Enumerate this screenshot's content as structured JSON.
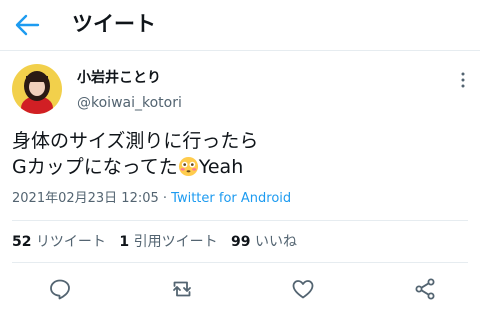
{
  "header": {
    "title": "ツイート"
  },
  "user": {
    "name": "小岩井ことり",
    "handle": "@koiwai_kotori"
  },
  "tweet": {
    "line1": "身体のサイズ測りに行ったら",
    "line2": "Gカップになってた",
    "line2_suffix": "Yeah",
    "emoji": "flushed-face-icon"
  },
  "meta": {
    "datetime": "2021年02月23日 12:05",
    "separator": " · ",
    "source": "Twitter for Android"
  },
  "stats": {
    "retweets": {
      "count": "52",
      "label": "リツイート"
    },
    "quotes": {
      "count": "1",
      "label": "引用ツイート"
    },
    "likes": {
      "count": "99",
      "label": "いいね"
    }
  },
  "colors": {
    "accent": "#1d9bf0",
    "secondary_text": "#536471",
    "divider": "#e6ecf0"
  },
  "icons": [
    "back-arrow-icon",
    "more-options-icon",
    "reply-icon",
    "retweet-icon",
    "like-icon",
    "share-icon"
  ]
}
